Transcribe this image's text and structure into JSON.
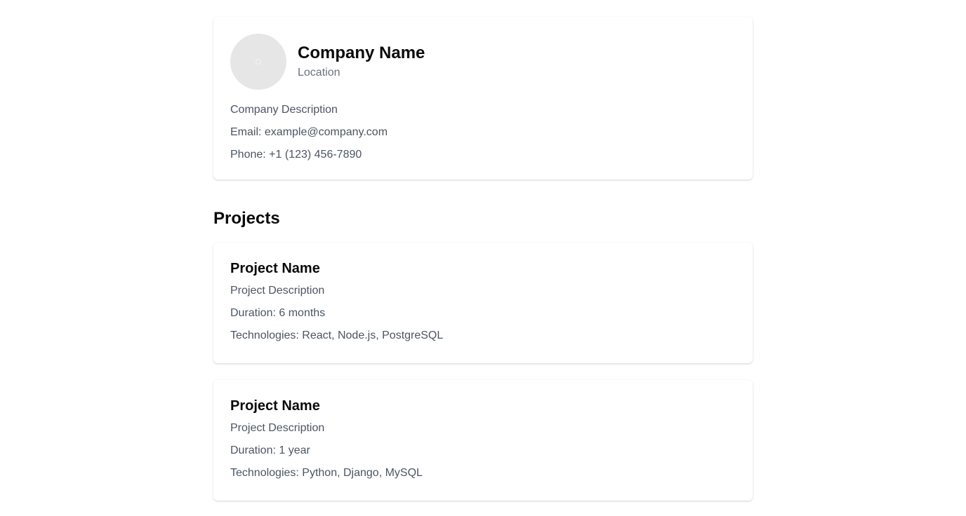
{
  "company": {
    "avatar_icon": "image-placeholder-icon",
    "name": "Company Name",
    "location": "Location",
    "description": "Company Description",
    "email": "Email: example@company.com",
    "phone": "Phone: +1 (123) 456-7890"
  },
  "projects_section": {
    "title": "Projects"
  },
  "projects": [
    {
      "name": "Project Name",
      "description": "Project Description",
      "duration": "Duration: 6 months",
      "technologies": "Technologies: React, Node.js, PostgreSQL"
    },
    {
      "name": "Project Name",
      "description": "Project Description",
      "duration": "Duration: 1 year",
      "technologies": "Technologies: Python, Django, MySQL"
    }
  ],
  "colors": {
    "heading": "#0a0a0a",
    "body_text": "#4b5563",
    "muted_text": "#6b7280",
    "avatar_bg": "#e6e6e6",
    "card_bg": "#ffffff"
  }
}
